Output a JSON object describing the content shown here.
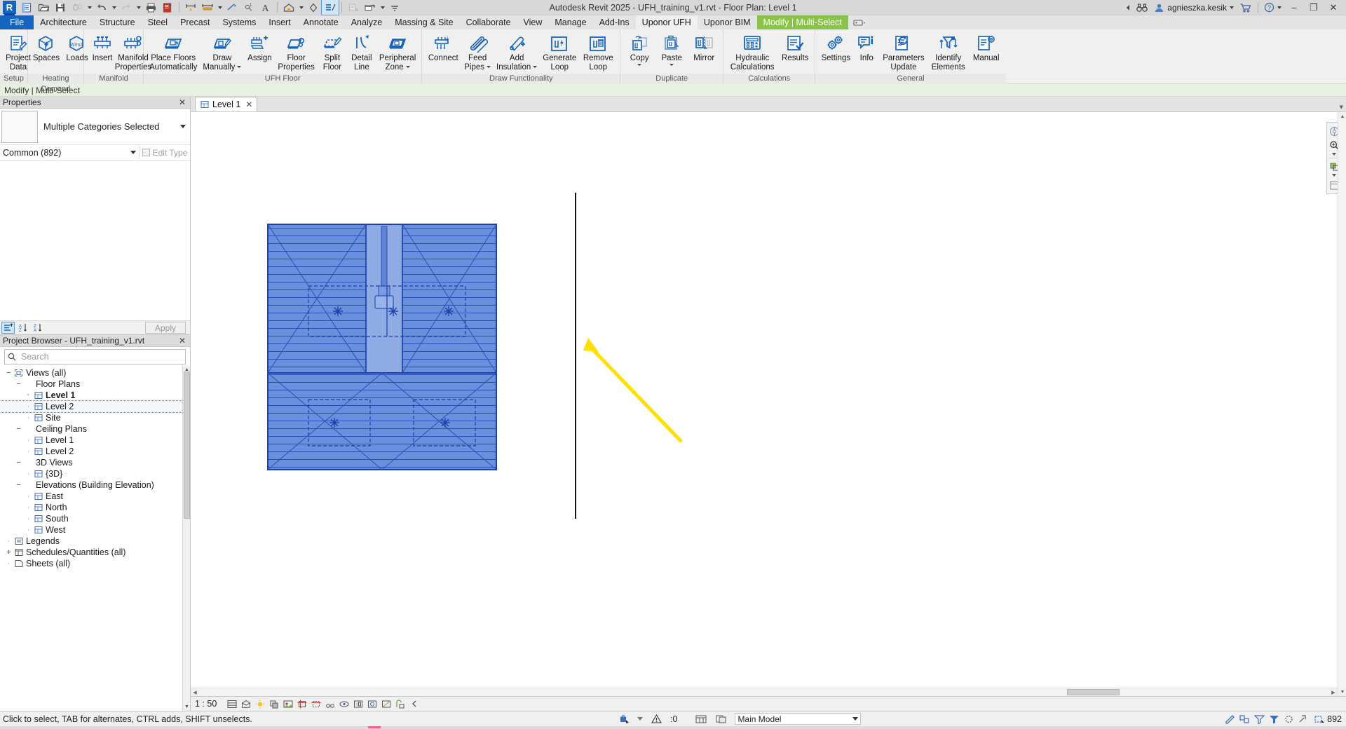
{
  "app": {
    "title": "Autodesk Revit 2025 - UFH_training_v1.rvt - Floor Plan: Level 1",
    "logo_letter": "R"
  },
  "quick_access": {
    "items": [
      {
        "name": "new-project-icon",
        "label": "New"
      },
      {
        "name": "open-icon",
        "label": "Open"
      },
      {
        "name": "save-icon",
        "label": "Save"
      },
      {
        "name": "sync-with-central-icon",
        "label": "Synchronize with Central"
      },
      {
        "name": "undo-icon",
        "label": "Undo"
      },
      {
        "name": "redo-icon",
        "label": "Redo"
      },
      {
        "name": "print-icon",
        "label": "Print"
      },
      {
        "name": "measure-sheet-icon",
        "label": "Sheet"
      },
      {
        "name": "aligned-dimension-icon",
        "label": "Aligned Dimension"
      },
      {
        "name": "tag-by-category-icon",
        "label": "Tag by Category"
      },
      {
        "name": "text-icon",
        "label": "Text"
      },
      {
        "name": "default-3d-view-icon",
        "label": "Default 3D View"
      },
      {
        "name": "section-icon",
        "label": "Section"
      },
      {
        "name": "thin-lines-icon",
        "label": "Thin Lines"
      },
      {
        "name": "close-hidden-windows-icon",
        "label": "Close Hidden Windows"
      },
      {
        "name": "switch-windows-icon",
        "label": "Switch Windows"
      },
      {
        "name": "customize-qat-icon",
        "label": "Customize Quick Access Toolbar"
      }
    ]
  },
  "title_right": {
    "search_placeholder": "",
    "collapse_icon": "collapse-left-icon",
    "binoculars_icon": "search-binoculars-icon",
    "user_icon": "user-account-icon",
    "user_name": "agnieszka.kesik",
    "cart_icon": "shopping-cart-icon",
    "help_icon": "help-icon",
    "minimize": "–",
    "restore": "❐",
    "close": "✕"
  },
  "ribbon": {
    "file_tab": "File",
    "tabs": [
      {
        "label": "Architecture",
        "active": false
      },
      {
        "label": "Structure",
        "active": false
      },
      {
        "label": "Steel",
        "active": false
      },
      {
        "label": "Precast",
        "active": false
      },
      {
        "label": "Systems",
        "active": false
      },
      {
        "label": "Insert",
        "active": false
      },
      {
        "label": "Annotate",
        "active": false
      },
      {
        "label": "Analyze",
        "active": false
      },
      {
        "label": "Massing & Site",
        "active": false
      },
      {
        "label": "Collaborate",
        "active": false
      },
      {
        "label": "View",
        "active": false
      },
      {
        "label": "Manage",
        "active": false
      },
      {
        "label": "Add-Ins",
        "active": false
      },
      {
        "label": "Uponor UFH",
        "active": true
      },
      {
        "label": "Uponor BIM",
        "active": false
      },
      {
        "label": "Modify | Multi-Select",
        "active": false,
        "modify": true
      }
    ],
    "panels": [
      {
        "title": "Setup",
        "buttons": [
          {
            "name": "project-data-button",
            "label": "Project\nData",
            "icon": "project-data-icon",
            "caret": false
          }
        ]
      },
      {
        "title": "Heating Demand",
        "buttons": [
          {
            "name": "spaces-button",
            "label": "Spaces",
            "icon": "spaces-icon",
            "caret": false
          },
          {
            "name": "loads-button",
            "label": "Loads",
            "icon": "loads-icon",
            "caret": false
          }
        ]
      },
      {
        "title": "Manifold",
        "buttons": [
          {
            "name": "insert-manifold-button",
            "label": "Insert",
            "icon": "manifold-insert-icon",
            "caret": false
          },
          {
            "name": "manifold-properties-button",
            "label": "Manifold\nProperties",
            "icon": "manifold-properties-icon",
            "caret": false
          }
        ]
      },
      {
        "title": "UFH Floor",
        "buttons": [
          {
            "name": "place-floors-automatically-button",
            "label": "Place Floors\nAutomatically",
            "icon": "place-floors-auto-icon",
            "caret": false
          },
          {
            "name": "draw-manually-button",
            "label": "Draw\nManually",
            "icon": "draw-manually-icon",
            "caret": true
          },
          {
            "name": "assign-button",
            "label": "Assign",
            "icon": "assign-icon",
            "caret": false
          },
          {
            "name": "floor-properties-button",
            "label": "Floor\nProperties",
            "icon": "floor-properties-icon",
            "caret": false
          },
          {
            "name": "split-floor-button",
            "label": "Split\nFloor",
            "icon": "split-floor-icon",
            "caret": false
          },
          {
            "name": "detail-line-button",
            "label": "Detail\nLine",
            "icon": "detail-line-icon",
            "caret": false
          },
          {
            "name": "peripheral-zone-button",
            "label": "Peripheral\nZone",
            "icon": "peripheral-zone-icon",
            "caret": true
          }
        ]
      },
      {
        "title": "Draw Functionality",
        "buttons": [
          {
            "name": "connect-button",
            "label": "Connect",
            "icon": "connect-icon",
            "caret": false
          },
          {
            "name": "feed-pipes-button",
            "label": "Feed\nPipes",
            "icon": "feed-pipes-icon",
            "caret": true
          },
          {
            "name": "add-insulation-button",
            "label": "Add\nInsulation",
            "icon": "add-insulation-icon",
            "caret": true
          },
          {
            "name": "generate-loop-button",
            "label": "Generate\nLoop",
            "icon": "generate-loop-icon",
            "caret": false
          },
          {
            "name": "remove-loop-button",
            "label": "Remove\nLoop",
            "icon": "remove-loop-icon",
            "caret": false
          }
        ]
      },
      {
        "title": "Duplicate",
        "buttons": [
          {
            "name": "copy-button",
            "label": "Copy",
            "icon": "copy-icon",
            "caret_below": true
          },
          {
            "name": "paste-button",
            "label": "Paste",
            "icon": "paste-icon",
            "caret_below": true
          },
          {
            "name": "mirror-button",
            "label": "Mirror",
            "icon": "mirror-icon",
            "caret": false
          }
        ]
      },
      {
        "title": "Calculations",
        "buttons": [
          {
            "name": "hydraulic-calculations-button",
            "label": "Hydraulic\nCalculations",
            "icon": "hydraulic-calculations-icon",
            "caret": false
          },
          {
            "name": "results-button",
            "label": "Results",
            "icon": "results-icon",
            "caret": false
          }
        ]
      },
      {
        "title": "General",
        "buttons": [
          {
            "name": "settings-button",
            "label": "Settings",
            "icon": "settings-gear-icon",
            "caret": false
          },
          {
            "name": "info-button",
            "label": "Info",
            "icon": "info-icon",
            "caret": false
          },
          {
            "name": "parameters-update-button",
            "label": "Parameters\nUpdate",
            "icon": "parameters-update-icon",
            "caret": false
          },
          {
            "name": "identify-elements-button",
            "label": "Identify\nElements",
            "icon": "identify-elements-icon",
            "caret": false
          },
          {
            "name": "manual-button",
            "label": "Manual",
            "icon": "manual-icon",
            "caret": false
          }
        ]
      }
    ]
  },
  "context_bar": {
    "text": "Modify | Multi-Select"
  },
  "properties": {
    "panel_title": "Properties",
    "type_name": "Multiple Categories Selected",
    "family_value": "Common (892)",
    "edit_type_label": "Edit Type",
    "apply_label": "Apply",
    "footer_icons": [
      "properties-list-icon",
      "sort-az-icon",
      "sort-za-icon"
    ]
  },
  "project_browser": {
    "panel_title": "Project Browser - UFH_training_v1.rvt",
    "search_placeholder": "Search",
    "tree": [
      {
        "label": "Views (all)",
        "level": 0,
        "icon": "views-icon",
        "expander": "minus",
        "bold": false
      },
      {
        "label": "Floor Plans",
        "level": 1,
        "icon": "none",
        "expander": "minus",
        "bold": false
      },
      {
        "label": "Level 1",
        "level": 2,
        "icon": "view-icon",
        "expander": "none",
        "bold": true
      },
      {
        "label": "Level 2",
        "level": 2,
        "icon": "view-icon",
        "expander": "none",
        "bold": false,
        "boxed": true
      },
      {
        "label": "Site",
        "level": 2,
        "icon": "view-icon",
        "expander": "none",
        "bold": false
      },
      {
        "label": "Ceiling Plans",
        "level": 1,
        "icon": "none",
        "expander": "minus",
        "bold": false
      },
      {
        "label": "Level 1",
        "level": 2,
        "icon": "view-icon",
        "expander": "none",
        "bold": false
      },
      {
        "label": "Level 2",
        "level": 2,
        "icon": "view-icon",
        "expander": "none",
        "bold": false
      },
      {
        "label": "3D Views",
        "level": 1,
        "icon": "none",
        "expander": "minus",
        "bold": false
      },
      {
        "label": "{3D}",
        "level": 2,
        "icon": "view-icon",
        "expander": "none",
        "bold": false
      },
      {
        "label": "Elevations (Building Elevation)",
        "level": 1,
        "icon": "none",
        "expander": "minus",
        "bold": false
      },
      {
        "label": "East",
        "level": 2,
        "icon": "view-icon",
        "expander": "none",
        "bold": false
      },
      {
        "label": "North",
        "level": 2,
        "icon": "view-icon",
        "expander": "none",
        "bold": false
      },
      {
        "label": "South",
        "level": 2,
        "icon": "view-icon",
        "expander": "none",
        "bold": false
      },
      {
        "label": "West",
        "level": 2,
        "icon": "view-icon",
        "expander": "none",
        "bold": false
      },
      {
        "label": "Legends",
        "level": 0,
        "icon": "legends-icon",
        "expander": "none",
        "bold": false
      },
      {
        "label": "Schedules/Quantities (all)",
        "level": 0,
        "icon": "schedules-icon",
        "expander": "plus",
        "bold": false
      },
      {
        "label": "Sheets (all)",
        "level": 0,
        "icon": "sheets-icon",
        "expander": "none",
        "bold": false
      }
    ]
  },
  "view_tab": {
    "label": "Level 1",
    "close": "✕"
  },
  "view_control_bar": {
    "scale": "1 : 50",
    "icons": [
      "detail-level-icon",
      "visual-style-icon",
      "sun-path-icon",
      "shadows-icon",
      "rendering-dialog-icon",
      "crop-view-icon",
      "crop-region-visible-icon",
      "lock-3d-view-icon",
      "temporary-hide-isolate-icon",
      "reveal-hidden-elements-icon",
      "temporary-view-properties-icon",
      "analytical-model-icon",
      "constraints-icon",
      "collapse-icon"
    ]
  },
  "status_bar": {
    "hint": "Click to select, TAB for alternates, CTRL adds, SHIFT unselects.",
    "filter_icon": "press-drag-icon",
    "exclude_options_label": "",
    "warning_count": ":0",
    "worksets_label": "",
    "design_option": "Main Model",
    "selection_count": "892",
    "right_icons": [
      "editable-only-icon",
      "design-options-icon",
      "exclude-options-icon",
      "filter-selection-icon",
      "temporary-hide-icon",
      "select-link-icon"
    ]
  },
  "canvas": {
    "annotation_arrow_color": "#FFE000",
    "floor_fill_color": "#5B7FD4",
    "floor_line_color": "#1C3FA8"
  }
}
